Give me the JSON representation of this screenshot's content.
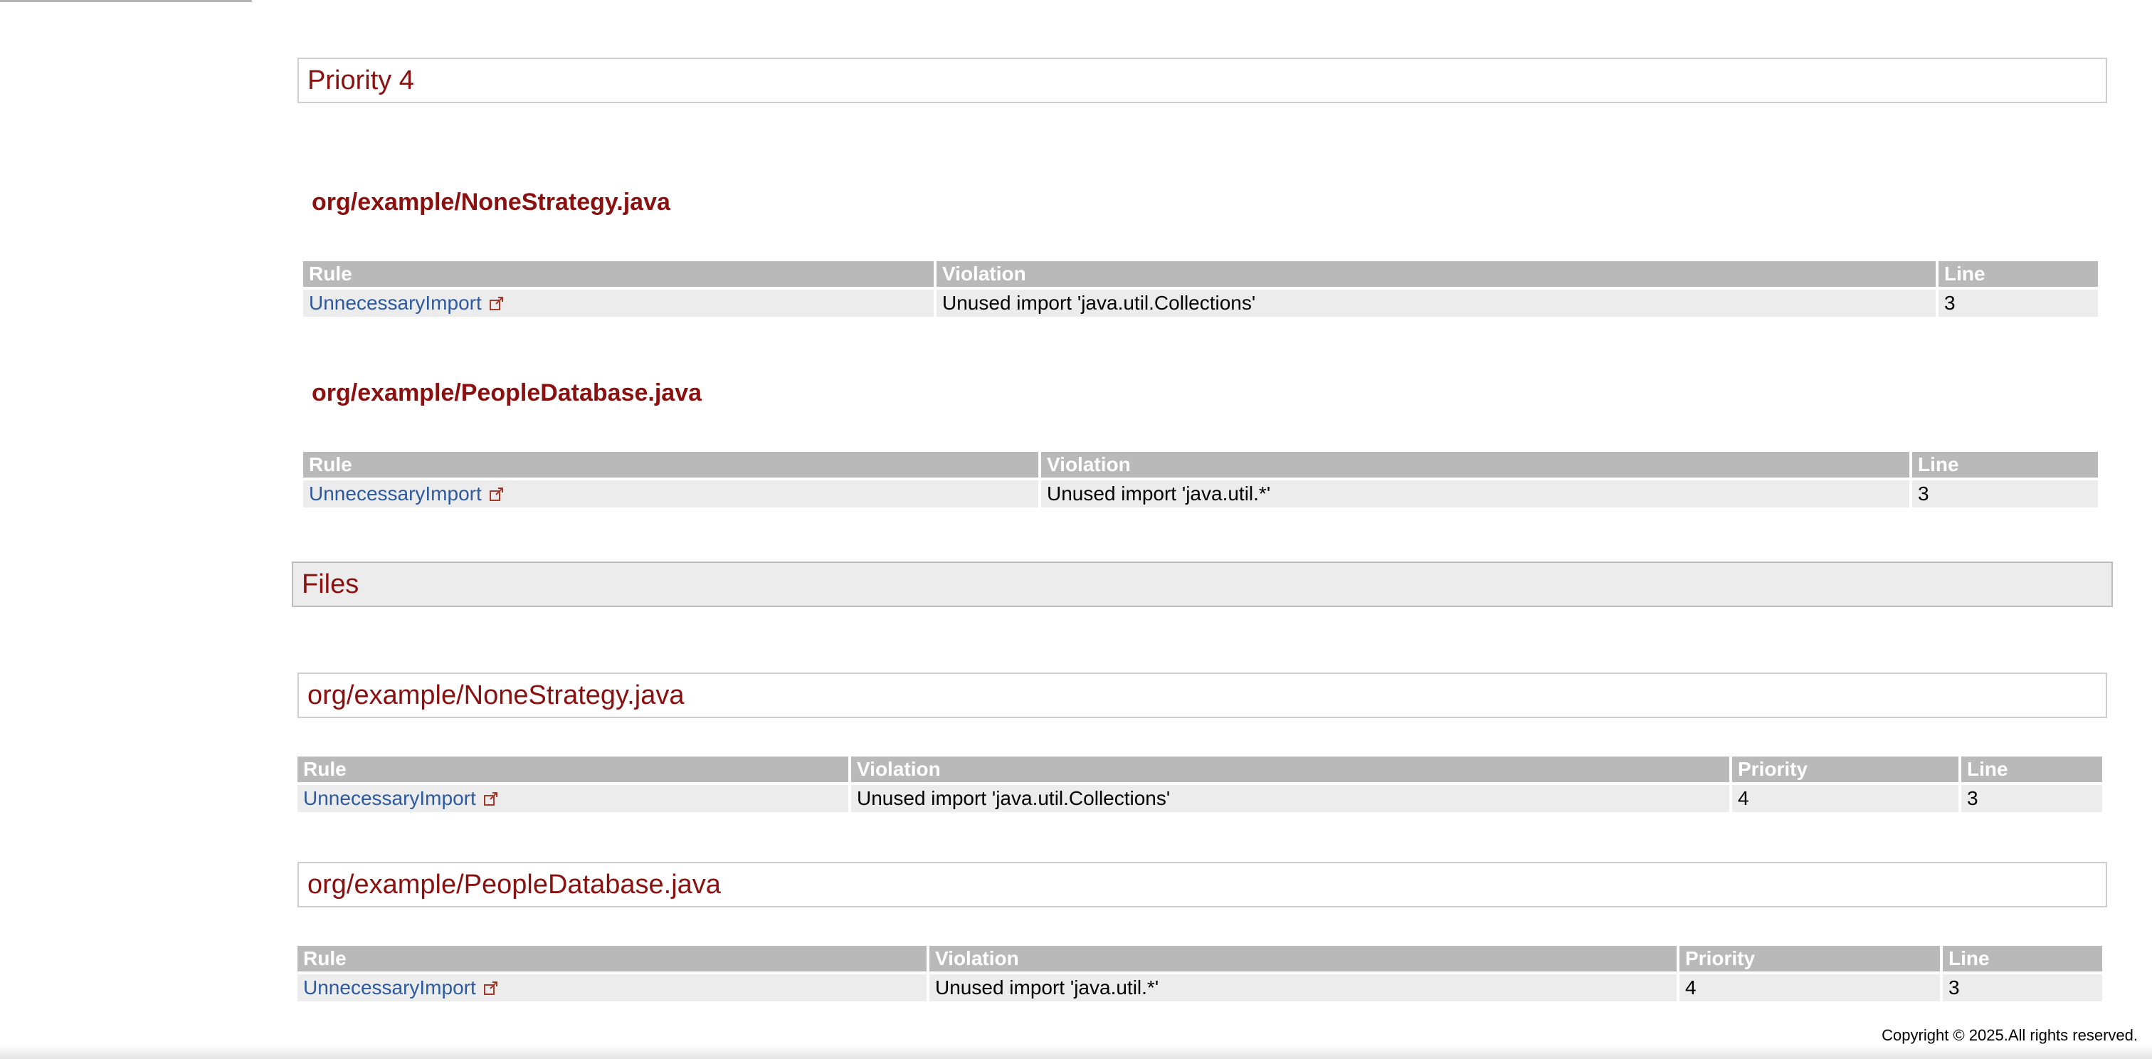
{
  "priority_section": {
    "title": "Priority 4",
    "files": [
      {
        "path": "org/example/NoneStrategy.java",
        "headers": [
          "Rule",
          "Violation",
          "Line"
        ],
        "rows": [
          {
            "rule": "UnnecessaryImport",
            "violation": "Unused import 'java.util.Collections'",
            "line": "3"
          }
        ]
      },
      {
        "path": "org/example/PeopleDatabase.java",
        "headers": [
          "Rule",
          "Violation",
          "Line"
        ],
        "rows": [
          {
            "rule": "UnnecessaryImport",
            "violation": "Unused import 'java.util.*'",
            "line": "3"
          }
        ]
      }
    ]
  },
  "files_section": {
    "title": "Files",
    "files": [
      {
        "path": "org/example/NoneStrategy.java",
        "headers": [
          "Rule",
          "Violation",
          "Priority",
          "Line"
        ],
        "rows": [
          {
            "rule": "UnnecessaryImport",
            "violation": "Unused import 'java.util.Collections'",
            "priority": "4",
            "line": "3"
          }
        ]
      },
      {
        "path": "org/example/PeopleDatabase.java",
        "headers": [
          "Rule",
          "Violation",
          "Priority",
          "Line"
        ],
        "rows": [
          {
            "rule": "UnnecessaryImport",
            "violation": "Unused import 'java.util.*'",
            "priority": "4",
            "line": "3"
          }
        ]
      }
    ]
  },
  "footer": {
    "copyright": "Copyright © 2025.All rights reserved."
  },
  "icons": {
    "rule_link_icon": "external-link-icon"
  },
  "colors": {
    "heading": "#8b1010",
    "link": "#2c5aa0",
    "table_header": "#b9b9b9",
    "table_row": "#ececec"
  }
}
